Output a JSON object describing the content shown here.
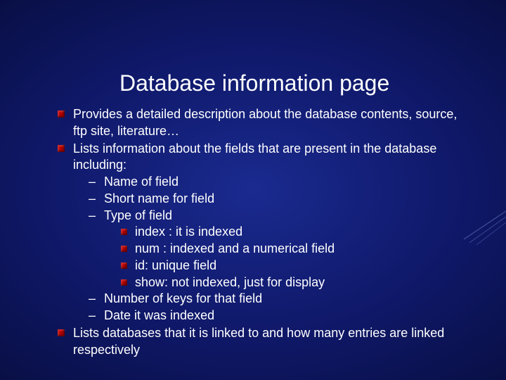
{
  "title": "Database information page",
  "items": [
    {
      "text": "Provides a detailed description about the database contents, source, ftp site, literature…"
    },
    {
      "text": "Lists information about the fields that are present in the database including:",
      "sub": [
        {
          "text": "Name of field"
        },
        {
          "text": "Short name for field"
        },
        {
          "text": "Type of field",
          "sub": [
            {
              "text": "index : it is indexed"
            },
            {
              "text": "num : indexed and a numerical field"
            },
            {
              "text": "id: unique field"
            },
            {
              "text": "show: not indexed, just for display"
            }
          ]
        },
        {
          "text": "Number of keys for that field"
        },
        {
          "text": "Date it was indexed"
        }
      ]
    },
    {
      "text": "Lists databases that it is linked to and how many entries are linked respectively"
    }
  ]
}
